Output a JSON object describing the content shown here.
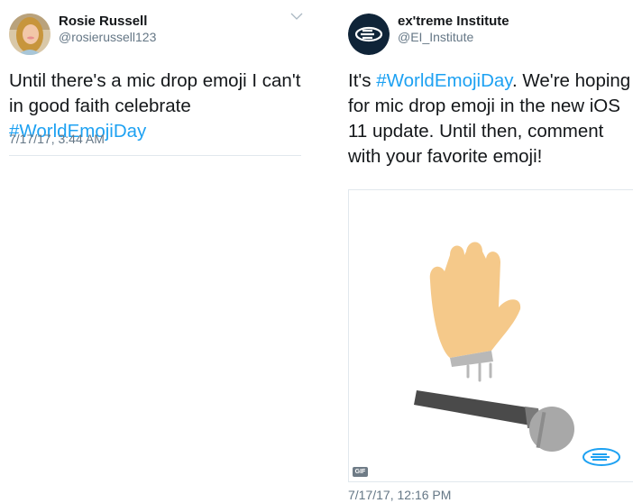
{
  "tweets": [
    {
      "author_name": "Rosie Russell",
      "author_handle": "@rosierussell123",
      "text_prefix": "Until there's a mic drop emoji I can't in good faith celebrate ",
      "hashtag": "#WorldEmojiDay",
      "text_suffix": "",
      "timestamp": "7/17/17, 3:44 AM",
      "icons": [
        "avatar-photo",
        "chevron-down-icon"
      ]
    },
    {
      "author_name": "ex'treme Institute",
      "author_handle": "@EI_Institute",
      "text_prefix": "It's ",
      "hashtag": "#WorldEmojiDay",
      "text_suffix": ". We're hoping for mic drop emoji in the new iOS 11 update. Until then, comment with your favorite emoji!",
      "media": {
        "type": "gif",
        "badge_label": "GIF",
        "description_icons": [
          "hand-icon",
          "microphone-icon",
          "ei-logo-icon"
        ]
      },
      "timestamp": "7/17/17, 12:16 PM"
    }
  ],
  "colors": {
    "hashtag": "#1da1f2",
    "secondary_text": "#657786",
    "divider": "#e1e8ed",
    "hand": "#f5c98a",
    "mic_body": "#4a4a4a",
    "mic_head": "#a8a8a8",
    "logo_blue": "#1da1f2"
  }
}
